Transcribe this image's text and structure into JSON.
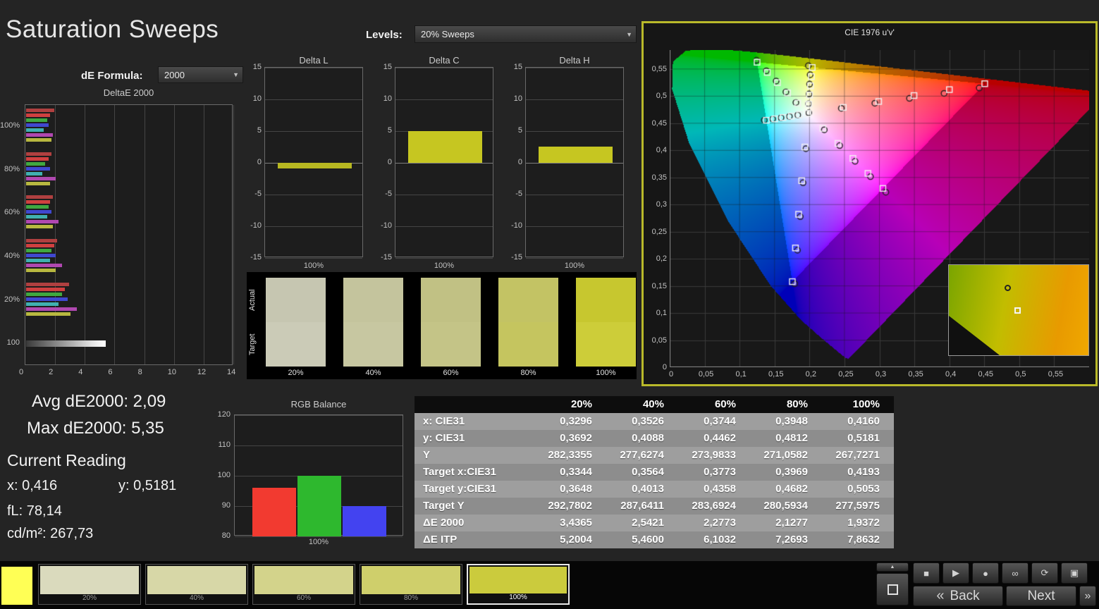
{
  "header": {
    "title": "Saturation Sweeps",
    "levels_label": "Levels:",
    "levels_value": "20% Sweeps",
    "de_formula_label": "dE Formula:",
    "de_formula_value": "2000",
    "dropdown_arrow": "▼"
  },
  "stats": {
    "avg_de2000": "Avg dE2000: 2,09",
    "max_de2000": "Max dE2000: 5,35",
    "current_reading_label": "Current Reading",
    "x_value": "x: 0,416",
    "y_value": "y: 0,5181",
    "fl_value": "fL: 78,14",
    "cdm2_value": "cd/m²: 267,73"
  },
  "chart_data": [
    {
      "id": "deltae_2000",
      "type": "bar",
      "orientation": "horizontal",
      "title": "DeltaE 2000",
      "xlim": [
        0,
        14
      ],
      "xticks": [
        "0",
        "2",
        "4",
        "6",
        "8",
        "10",
        "12",
        "14"
      ],
      "grid": true,
      "groups": [
        {
          "label": "100%",
          "bars": [
            {
              "color": "#b04040",
              "value": 1.9
            },
            {
              "color": "#d04040",
              "value": 1.6
            },
            {
              "color": "#40a840",
              "value": 1.4
            },
            {
              "color": "#4048d0",
              "value": 1.5
            },
            {
              "color": "#40b0b0",
              "value": 1.2
            },
            {
              "color": "#b048b0",
              "value": 1.8
            },
            {
              "color": "#b8b840",
              "value": 1.7
            }
          ]
        },
        {
          "label": "80%",
          "bars": [
            {
              "color": "#b04040",
              "value": 1.7
            },
            {
              "color": "#d04040",
              "value": 1.5
            },
            {
              "color": "#40a840",
              "value": 1.3
            },
            {
              "color": "#4048d0",
              "value": 1.6
            },
            {
              "color": "#40b0b0",
              "value": 1.1
            },
            {
              "color": "#b048b0",
              "value": 2.0
            },
            {
              "color": "#b8b840",
              "value": 1.6
            }
          ]
        },
        {
          "label": "60%",
          "bars": [
            {
              "color": "#b04040",
              "value": 1.8
            },
            {
              "color": "#d04040",
              "value": 1.6
            },
            {
              "color": "#40a840",
              "value": 1.5
            },
            {
              "color": "#4048d0",
              "value": 1.7
            },
            {
              "color": "#40b0b0",
              "value": 1.4
            },
            {
              "color": "#b048b0",
              "value": 2.2
            },
            {
              "color": "#b8b840",
              "value": 1.8
            }
          ]
        },
        {
          "label": "40%",
          "bars": [
            {
              "color": "#b04040",
              "value": 2.1
            },
            {
              "color": "#d04040",
              "value": 1.9
            },
            {
              "color": "#40a840",
              "value": 1.7
            },
            {
              "color": "#4048d0",
              "value": 2.0
            },
            {
              "color": "#40b0b0",
              "value": 1.6
            },
            {
              "color": "#b048b0",
              "value": 2.4
            },
            {
              "color": "#b8b840",
              "value": 2.0
            }
          ]
        },
        {
          "label": "20%",
          "bars": [
            {
              "color": "#b04040",
              "value": 2.9
            },
            {
              "color": "#d04040",
              "value": 2.6
            },
            {
              "color": "#40a840",
              "value": 2.4
            },
            {
              "color": "#4048d0",
              "value": 2.8
            },
            {
              "color": "#40b0b0",
              "value": 2.2
            },
            {
              "color": "#b048b0",
              "value": 3.4
            },
            {
              "color": "#b8b840",
              "value": 3.0
            }
          ]
        },
        {
          "label": "100",
          "bars": [
            {
              "gradient": true,
              "value": 5.35
            }
          ]
        }
      ]
    },
    {
      "id": "delta_l",
      "type": "bar",
      "title": "Delta L",
      "ylim": [
        -15,
        15
      ],
      "yticks": [
        "15",
        "10",
        "5",
        "0",
        "-5",
        "-10",
        "-15"
      ],
      "categories": [
        "100%"
      ],
      "values": [
        -0.9
      ],
      "bar_color": "#b8b821"
    },
    {
      "id": "delta_c",
      "type": "bar",
      "title": "Delta C",
      "ylim": [
        -15,
        15
      ],
      "yticks": [
        "15",
        "10",
        "5",
        "0",
        "-5",
        "-10",
        "-15"
      ],
      "categories": [
        "100%"
      ],
      "values": [
        5.0
      ],
      "bar_color": "#c6c621"
    },
    {
      "id": "delta_h",
      "type": "bar",
      "title": "Delta H",
      "ylim": [
        -15,
        15
      ],
      "yticks": [
        "15",
        "10",
        "5",
        "0",
        "-5",
        "-10",
        "-15"
      ],
      "categories": [
        "100%"
      ],
      "values": [
        2.6
      ],
      "bar_color": "#c6c621"
    },
    {
      "id": "rgb_balance",
      "type": "bar",
      "title": "RGB Balance",
      "ylim": [
        80,
        120
      ],
      "yticks": [
        "120",
        "110",
        "100",
        "90",
        "80"
      ],
      "categories": [
        "100%"
      ],
      "series": [
        {
          "name": "red",
          "color": "#f23a30",
          "value": 96
        },
        {
          "name": "green",
          "color": "#2eb82e",
          "value": 100
        },
        {
          "name": "blue",
          "color": "#4343f0",
          "value": 90
        }
      ]
    },
    {
      "id": "cie_1976",
      "type": "scatter",
      "title": "CIE 1976 u'v'",
      "xlim": [
        0,
        0.6
      ],
      "ylim": [
        0,
        0.585
      ],
      "tick_step": 0.05,
      "xtick_labels": [
        "0",
        "0,05",
        "0,1",
        "0,15",
        "0,2",
        "0,25",
        "0,3",
        "0,35",
        "0,4",
        "0,45",
        "0,5",
        "0,55"
      ],
      "ytick_labels": [
        "0",
        "0,05",
        "0,1",
        "0,15",
        "0,2",
        "0,25",
        "0,3",
        "0,35",
        "0,4",
        "0,45",
        "0,5",
        "0,55"
      ],
      "targets": [
        [
          0.2484,
          0.4792
        ],
        [
          0.299,
          0.4901
        ],
        [
          0.3495,
          0.5011
        ],
        [
          0.4001,
          0.512
        ],
        [
          0.4507,
          0.5229
        ],
        [
          0.1832,
          0.4871
        ],
        [
          0.1687,
          0.506
        ],
        [
          0.1541,
          0.5248
        ],
        [
          0.1396,
          0.5437
        ],
        [
          0.125,
          0.5625
        ],
        [
          0.1933,
          0.4062
        ],
        [
          0.1888,
          0.3441
        ],
        [
          0.1844,
          0.2821
        ],
        [
          0.1799,
          0.22
        ],
        [
          0.1754,
          0.1579
        ],
        [
          0.1859,
          0.4657
        ],
        [
          0.174,
          0.4632
        ],
        [
          0.1621,
          0.4606
        ],
        [
          0.1502,
          0.4581
        ],
        [
          0.1383,
          0.4555
        ],
        [
          0.2192,
          0.4406
        ],
        [
          0.2407,
          0.4129
        ],
        [
          0.2621,
          0.3852
        ],
        [
          0.2836,
          0.3575
        ],
        [
          0.305,
          0.3298
        ],
        [
          0.199,
          0.4852
        ],
        [
          0.2002,
          0.5021
        ],
        [
          0.2014,
          0.519
        ],
        [
          0.2027,
          0.536
        ],
        [
          0.2039,
          0.5529
        ],
        [
          0.1978,
          0.4683
        ]
      ],
      "measurements": [
        [
          0.2455,
          0.4775
        ],
        [
          0.2935,
          0.487
        ],
        [
          0.343,
          0.4958
        ],
        [
          0.3925,
          0.5052
        ],
        [
          0.4428,
          0.515
        ],
        [
          0.1805,
          0.4882
        ],
        [
          0.1662,
          0.5078
        ],
        [
          0.1523,
          0.5279
        ],
        [
          0.1383,
          0.5468
        ],
        [
          0.1243,
          0.566
        ],
        [
          0.1948,
          0.403
        ],
        [
          0.1908,
          0.3402
        ],
        [
          0.1868,
          0.2778
        ],
        [
          0.1828,
          0.2158
        ],
        [
          0.1788,
          0.1542
        ],
        [
          0.1832,
          0.4652
        ],
        [
          0.1712,
          0.4625
        ],
        [
          0.1592,
          0.4601
        ],
        [
          0.1473,
          0.4579
        ],
        [
          0.1353,
          0.4558
        ],
        [
          0.2212,
          0.4378
        ],
        [
          0.2432,
          0.4088
        ],
        [
          0.2652,
          0.3798
        ],
        [
          0.2872,
          0.3515
        ],
        [
          0.3092,
          0.3228
        ],
        [
          0.1985,
          0.486
        ],
        [
          0.1993,
          0.504
        ],
        [
          0.2001,
          0.5222
        ],
        [
          0.2009,
          0.5395
        ],
        [
          0.1984,
          0.5561
        ],
        [
          0.199,
          0.4692
        ]
      ]
    },
    {
      "id": "sweep_patches",
      "type": "table",
      "row_labels": [
        "Actual",
        "Target"
      ],
      "columns": [
        "20%",
        "40%",
        "60%",
        "80%",
        "100%"
      ],
      "actual_colors": [
        "#c6c6b1",
        "#c4c49d",
        "#c1c184",
        "#c3c364",
        "#c7c72f"
      ],
      "target_colors": [
        "#cbcbb7",
        "#c7c7a1",
        "#c4c487",
        "#c5c55f",
        "#cdcd39"
      ]
    },
    {
      "id": "results_table",
      "type": "table",
      "columns": [
        "",
        "20%",
        "40%",
        "60%",
        "80%",
        "100%"
      ],
      "rows": [
        {
          "label": "x: CIE31",
          "values": [
            "0,3296",
            "0,3526",
            "0,3744",
            "0,3948",
            "0,4160"
          ]
        },
        {
          "label": "y: CIE31",
          "values": [
            "0,3692",
            "0,4088",
            "0,4462",
            "0,4812",
            "0,5181"
          ]
        },
        {
          "label": "Y",
          "values": [
            "282,3355",
            "277,6274",
            "273,9833",
            "271,0582",
            "267,7271"
          ]
        },
        {
          "label": "Target x:CIE31",
          "values": [
            "0,3344",
            "0,3564",
            "0,3773",
            "0,3969",
            "0,4193"
          ]
        },
        {
          "label": "Target y:CIE31",
          "values": [
            "0,3648",
            "0,4013",
            "0,4358",
            "0,4682",
            "0,5053"
          ]
        },
        {
          "label": "Target Y",
          "values": [
            "292,7802",
            "287,6411",
            "283,6924",
            "280,5934",
            "277,5975"
          ]
        },
        {
          "label": "ΔE 2000",
          "values": [
            "3,4365",
            "2,5421",
            "2,2773",
            "2,1277",
            "1,9372"
          ]
        },
        {
          "label": "ΔE ITP",
          "values": [
            "5,2004",
            "5,4600",
            "6,1032",
            "7,2693",
            "7,8632"
          ]
        }
      ]
    }
  ],
  "toolbar": {
    "reference_color": "#ffff55",
    "swatches": [
      {
        "label": "20%",
        "color": "#dadabd",
        "selected": false
      },
      {
        "label": "40%",
        "color": "#d7d7a7",
        "selected": false
      },
      {
        "label": "60%",
        "color": "#d3d38b",
        "selected": false
      },
      {
        "label": "80%",
        "color": "#cfcf6b",
        "selected": false
      },
      {
        "label": "100%",
        "color": "#cbcb3d",
        "selected": true
      }
    ],
    "transport_icons": [
      {
        "name": "stop-icon",
        "glyph": "■"
      },
      {
        "name": "play-icon",
        "glyph": "▶"
      },
      {
        "name": "record-icon",
        "glyph": "●"
      },
      {
        "name": "continuous-measure-icon",
        "glyph": "∞"
      },
      {
        "name": "refresh-icon",
        "glyph": "⟳"
      },
      {
        "name": "capture-icon",
        "glyph": "▣"
      }
    ],
    "nav": {
      "back_label": "Back",
      "next_label": "Next",
      "back_chevron": "«",
      "next_chevron": "»",
      "up_chevron": "▲"
    }
  }
}
